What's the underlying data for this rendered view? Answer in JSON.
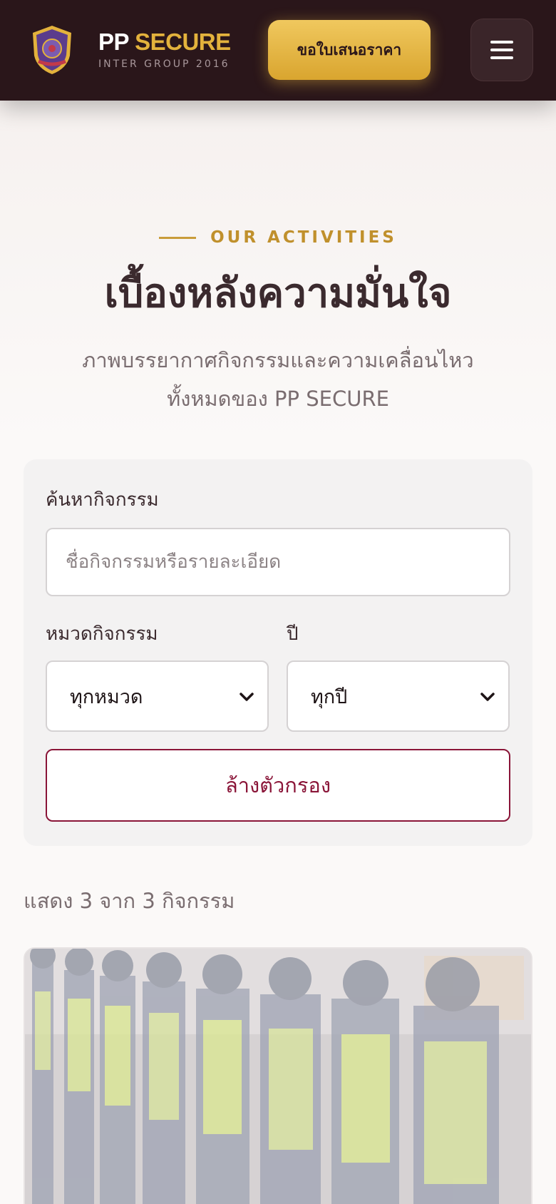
{
  "header": {
    "brand_pp": "PP",
    "brand_secure": "SECURE",
    "brand_sub": "INTER GROUP 2016",
    "quote_button": "ขอใบเสนอราคา",
    "logo_icon": "shield-badge-icon",
    "menu_icon": "hamburger-menu-icon"
  },
  "hero": {
    "eyebrow": "OUR ACTIVITIES",
    "title": "เบื้องหลังความมั่นใจ",
    "description_line1": "ภาพบรรยากาศกิจกรรมและความเคลื่อนไหว",
    "description_line2": "ทั้งหมดของ PP SECURE"
  },
  "filters": {
    "search_label": "ค้นหากิจกรรม",
    "search_placeholder": "ชื่อกิจกรรมหรือรายละเอียด",
    "search_value": "",
    "category_label": "หมวดกิจกรรม",
    "category_selected": "ทุกหมวด",
    "year_label": "ปี",
    "year_selected": "ทุกปี",
    "clear_button": "ล้างตัวกรอง"
  },
  "results": {
    "count_text": "แสดง 3 จาก 3 กิจกรรม"
  },
  "activities": [
    {
      "image": "security-guards-lineup-photo"
    }
  ],
  "colors": {
    "header_bg": "#2a161a",
    "accent_gold": "#e3b23c",
    "accent_maroon": "#8a1538",
    "text_dark": "#3b2a2e",
    "text_muted": "#7a6d70"
  }
}
